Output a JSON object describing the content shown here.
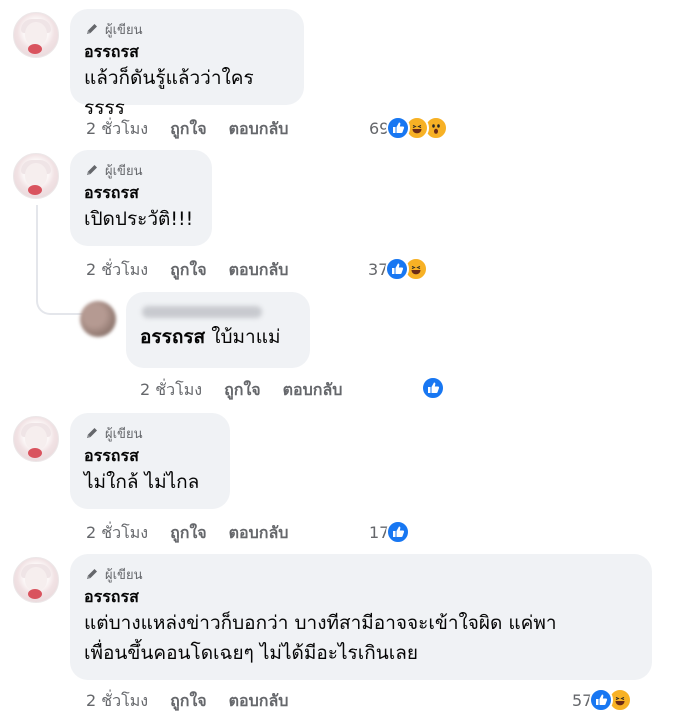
{
  "badge_label": "ผู้เขียน",
  "comments": [
    {
      "author": "อรรถรส",
      "text": [
        "แล้วก็ดันรู้แล้วว่าใครรรรร"
      ],
      "time": "2 ชั่วโมง",
      "like": "ถูกใจ",
      "reply": "ตอบกลับ",
      "reaction_count": "69",
      "reactions": [
        "like-icon",
        "haha-icon",
        "wow-icon"
      ]
    },
    {
      "author": "อรรถรส",
      "text": [
        "เปิดประวัติ!!!"
      ],
      "time": "2 ชั่วโมง",
      "like": "ถูกใจ",
      "reply": "ตอบกลับ",
      "reaction_count": "37",
      "reactions": [
        "like-icon",
        "haha-icon"
      ]
    },
    {
      "author": "อรรถรส",
      "text": [
        "ไม่ใกล้ ไม่ไกล"
      ],
      "time": "2 ชั่วโมง",
      "like": "ถูกใจ",
      "reply": "ตอบกลับ",
      "reaction_count": "17",
      "reactions": [
        "like-icon"
      ]
    },
    {
      "author": "อรรถรส",
      "text": [
        "แต่บางแหล่งข่าวก็บอกว่า บางทีสามีอาจจะเข้าใจผิด แค่พา",
        "เพื่อนขึ้นคอนโดเฉยๆ ไม่ได้มีอะไรเกินเลย"
      ],
      "time": "2 ชั่วโมง",
      "like": "ถูกใจ",
      "reply": "ตอบกลับ",
      "reaction_count": "57",
      "reactions": [
        "like-icon",
        "haha-icon"
      ]
    }
  ],
  "reply": {
    "mention": "อรรถรส",
    "text": "ใบ้มาแม่",
    "time": "2 ชั่วโมง",
    "like": "ถูกใจ",
    "reply": "ตอบกลับ",
    "reactions": [
      "like-icon"
    ]
  },
  "colors": {
    "bubble": "#f0f2f5",
    "meta": "#65676b",
    "like_blue": "#1877f2",
    "emoji_yellow": "#f7b125"
  }
}
